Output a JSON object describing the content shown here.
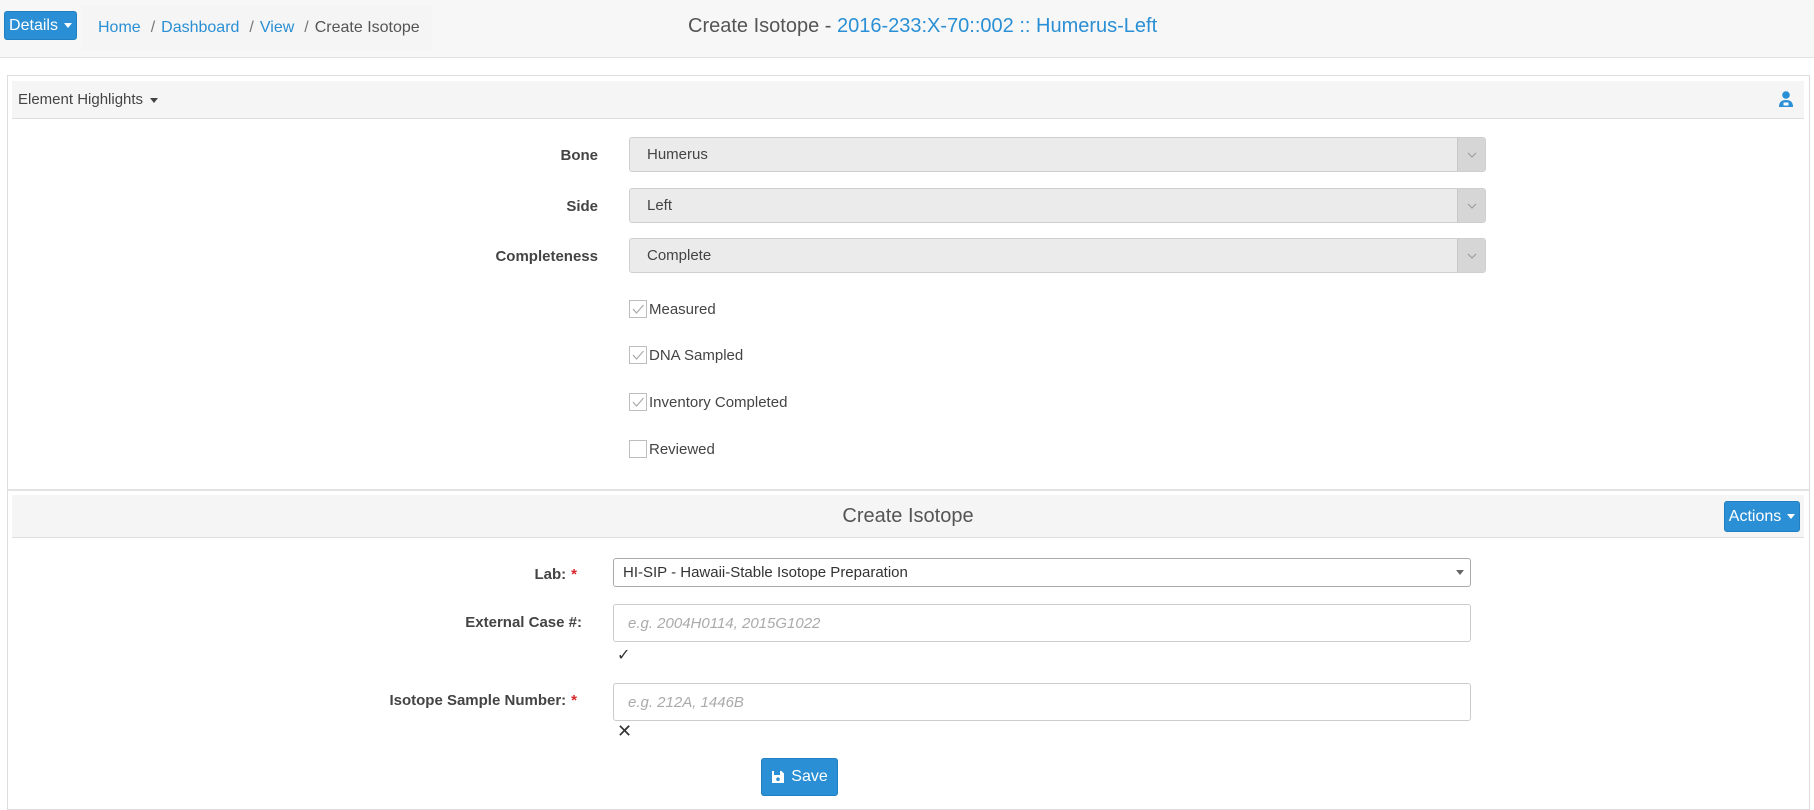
{
  "header": {
    "details_label": "Details",
    "breadcrumb": {
      "home": "Home",
      "dashboard": "Dashboard",
      "view": "View",
      "current": "Create Isotope",
      "separator": "/"
    },
    "title_prefix": "Create Isotope - ",
    "title_highlight": "2016-233:X-70::002 :: Humerus-Left"
  },
  "element_panel": {
    "toggle_label": "Element Highlights",
    "bone_label": "Bone",
    "bone_value": "Humerus",
    "side_label": "Side",
    "side_value": "Left",
    "completeness_label": "Completeness",
    "completeness_value": "Complete",
    "checks": [
      {
        "label": "Measured",
        "checked": true
      },
      {
        "label": "DNA Sampled",
        "checked": true
      },
      {
        "label": "Inventory Completed",
        "checked": true
      },
      {
        "label": "Reviewed",
        "checked": false
      }
    ]
  },
  "isotope_form": {
    "heading": "Create Isotope",
    "actions_label": "Actions",
    "lab_label": "Lab:",
    "lab_value": "HI-SIP - Hawaii-Stable Isotope Preparation",
    "external_case_label": "External Case #:",
    "external_case_placeholder": "e.g. 2004H0114, 2015G1022",
    "external_case_status": "✓",
    "sample_number_label": "Isotope Sample Number:",
    "sample_number_placeholder": "e.g. 212A, 1446B",
    "sample_number_status": "✕",
    "required_mark": "*",
    "save_label": "Save"
  },
  "colors": {
    "primary": "#2a8fd4",
    "required": "#d9252b",
    "readonly_bg": "#ebebeb"
  }
}
